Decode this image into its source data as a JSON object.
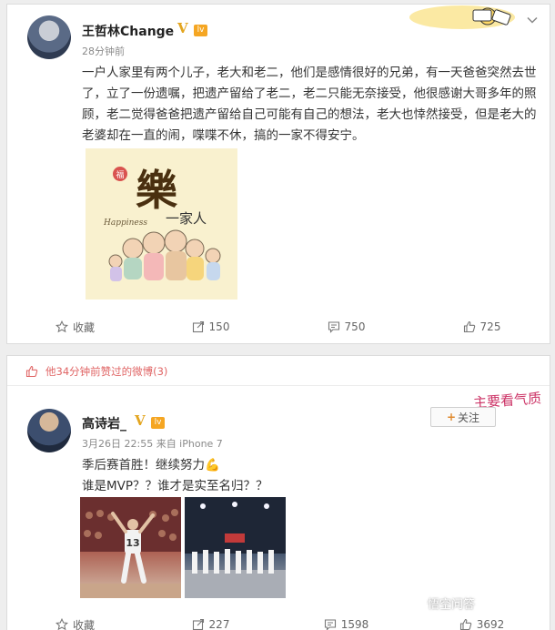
{
  "post1": {
    "username": "王哲林Change",
    "verified": "V",
    "level": "lv",
    "time": "28分钟前",
    "text": "一户人家里有两个儿子，老大和老二，他们是感情很好的兄弟，有一天爸爸突然去世了，立了一份遗嘱，把遗产留给了老二，老二只能无奈接受，他很感谢大哥多年的照顾，老二觉得爸爸把遗产留给自己可能有自己的想法，老大也悻然接受，但是老大的老婆却在一直的闹，喋喋不休，搞的一家不得安宁。",
    "image": {
      "char": "樂",
      "seal": "福",
      "happiness": "Happiness",
      "family": "一家人"
    },
    "actions": {
      "favorite": "收藏",
      "repost": "150",
      "comment": "750",
      "like": "725"
    }
  },
  "liked_banner": "他34分钟前赞过的微博(3)",
  "post2": {
    "username": "高诗岩_",
    "verified": "V",
    "level": "lv",
    "time": "3月26日 22:55 来自 iPhone 7",
    "follow_label": "关注",
    "decoration": "主要看气质",
    "line1": "季后赛首胜！继续努力💪",
    "line2": "谁是MVP？？谁才是实至名归？？",
    "jersey": "13",
    "actions": {
      "favorite": "收藏",
      "repost": "227",
      "comment": "1598",
      "like": "3692"
    }
  },
  "watermark": "悟空问答",
  "colors": {
    "verified": "#e3a51f",
    "liked_red": "#e06666",
    "card_bg": "#ffffff",
    "page_bg": "#eeeeee"
  }
}
